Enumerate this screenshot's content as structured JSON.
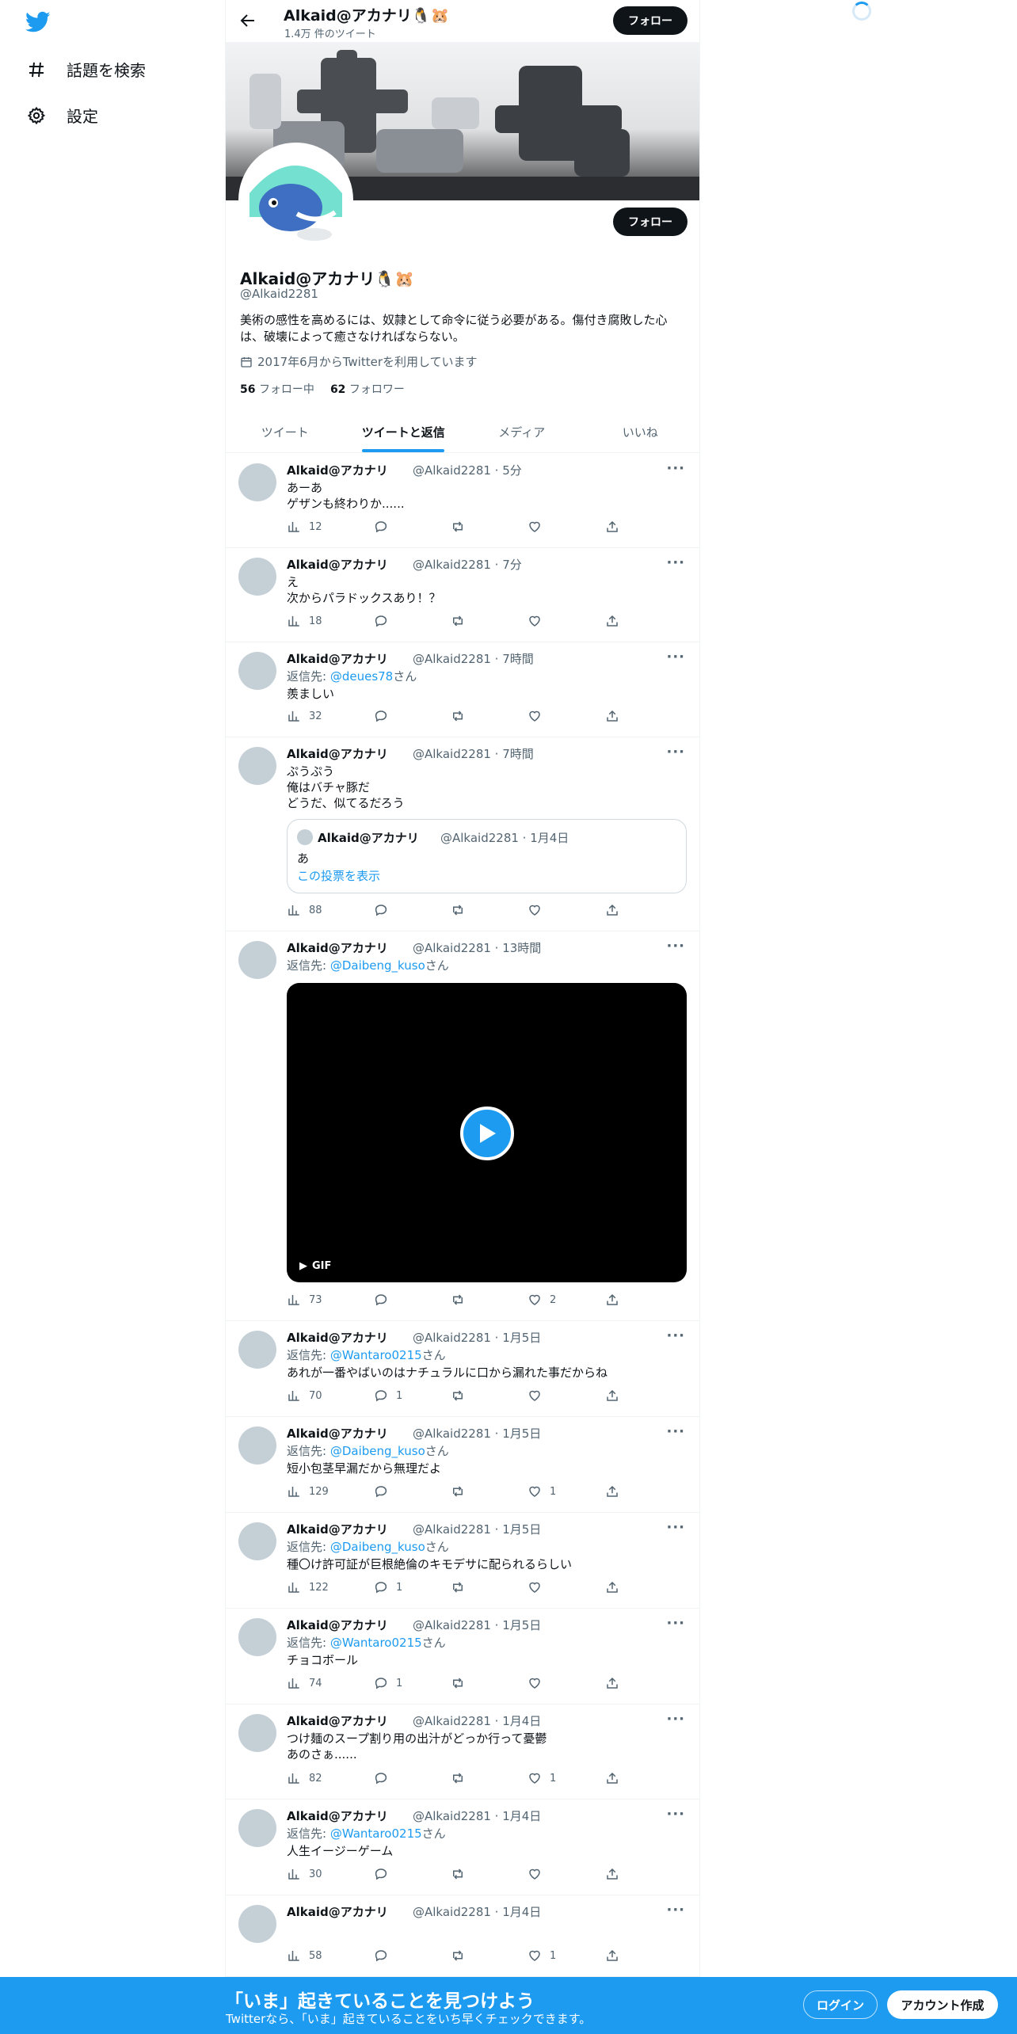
{
  "nav": {
    "explore_label": "話題を検索",
    "settings_label": "設定"
  },
  "header": {
    "name": "Alkaid@アカナリ🐧🐹",
    "tweet_count": "1.4万 件のツイート",
    "follow_label": "フォロー"
  },
  "profile": {
    "name": "Alkaid@アカナリ🐧🐹",
    "handle": "@Alkaid2281",
    "bio": "美術の感性を高めるには、奴隷として命令に従う必要がある。傷付き腐敗した心は、破壊によって癒さなければならない。",
    "joined": "2017年6月からTwitterを利用しています",
    "following_count": "56",
    "following_label": "フォロー中",
    "followers_count": "62",
    "followers_label": "フォロワー",
    "follow_label": "フォロー"
  },
  "tabs": [
    {
      "label": "ツイート"
    },
    {
      "label": "ツイートと返信"
    },
    {
      "label": "メディア"
    },
    {
      "label": "いいね"
    }
  ],
  "reply_prefix": "返信先: ",
  "reply_suffix": "さん",
  "tweets": [
    {
      "name": "Alkaid@アカナリ",
      "meta": "@Alkaid2281 · 5分",
      "text": "あーあ\nゲザンも終わりか......",
      "views": "12",
      "replies": "",
      "likes": ""
    },
    {
      "name": "Alkaid@アカナリ",
      "meta": "@Alkaid2281 · 7分",
      "text": "え\n次からパラドックスあり！？",
      "views": "18",
      "replies": "",
      "likes": ""
    },
    {
      "name": "Alkaid@アカナリ",
      "meta": "@Alkaid2281 · 7時間",
      "reply_to": "@deues78",
      "text": "羨ましい",
      "views": "32",
      "replies": "",
      "likes": ""
    },
    {
      "name": "Alkaid@アカナリ",
      "meta": "@Alkaid2281 · 7時間",
      "text": "ぷうぷう\n俺はバチャ豚だ\nどうだ、似てるだろう",
      "views": "88",
      "replies": "",
      "likes": "",
      "quote": {
        "name": "Alkaid@アカナリ",
        "meta": "@Alkaid2281 · 1月4日",
        "text": "あ",
        "link": "この投票を表示"
      }
    },
    {
      "name": "Alkaid@アカナリ",
      "meta": "@Alkaid2281 · 13時間",
      "reply_to": "@Daibeng_kuso",
      "text": "",
      "views": "73",
      "replies": "",
      "likes": "2",
      "gif_label": "GIF"
    },
    {
      "name": "Alkaid@アカナリ",
      "meta": "@Alkaid2281 · 1月5日",
      "reply_to": "@Wantaro0215",
      "text": "あれが一番やばいのはナチュラルに口から漏れた事だからね",
      "views": "70",
      "replies": "1",
      "likes": ""
    },
    {
      "name": "Alkaid@アカナリ",
      "meta": "@Alkaid2281 · 1月5日",
      "reply_to": "@Daibeng_kuso",
      "text": "短小包茎早漏だから無理だよ",
      "views": "129",
      "replies": "",
      "likes": "1"
    },
    {
      "name": "Alkaid@アカナリ",
      "meta": "@Alkaid2281 · 1月5日",
      "reply_to": "@Daibeng_kuso",
      "text": "種〇け許可証が巨根絶倫のキモデサに配られるらしい",
      "views": "122",
      "replies": "1",
      "likes": ""
    },
    {
      "name": "Alkaid@アカナリ",
      "meta": "@Alkaid2281 · 1月5日",
      "reply_to": "@Wantaro0215",
      "text": "チョコボール",
      "views": "74",
      "replies": "1",
      "likes": ""
    },
    {
      "name": "Alkaid@アカナリ",
      "meta": "@Alkaid2281 · 1月4日",
      "text": "つけ麺のスープ割り用の出汁がどっか行って憂鬱\nあのさぁ......",
      "views": "82",
      "replies": "",
      "likes": "1"
    },
    {
      "name": "Alkaid@アカナリ",
      "meta": "@Alkaid2281 · 1月4日",
      "reply_to": "@Wantaro0215",
      "text": "人生イージーゲーム",
      "views": "30",
      "replies": "",
      "likes": ""
    },
    {
      "name": "Alkaid@アカナリ",
      "meta": "@Alkaid2281 · 1月4日",
      "text": "",
      "views": "58",
      "replies": "",
      "likes": "1"
    }
  ],
  "bottom": {
    "title": "「いま」起きていることを見つけよう",
    "subtitle": "Twitterなら、「いま」起きていることをいち早くチェックできます。",
    "login_label": "ログイン",
    "signup_label": "アカウント作成"
  },
  "colors": {
    "accent": "#1d9bf0",
    "text": "#0f1419",
    "muted": "#536471"
  }
}
